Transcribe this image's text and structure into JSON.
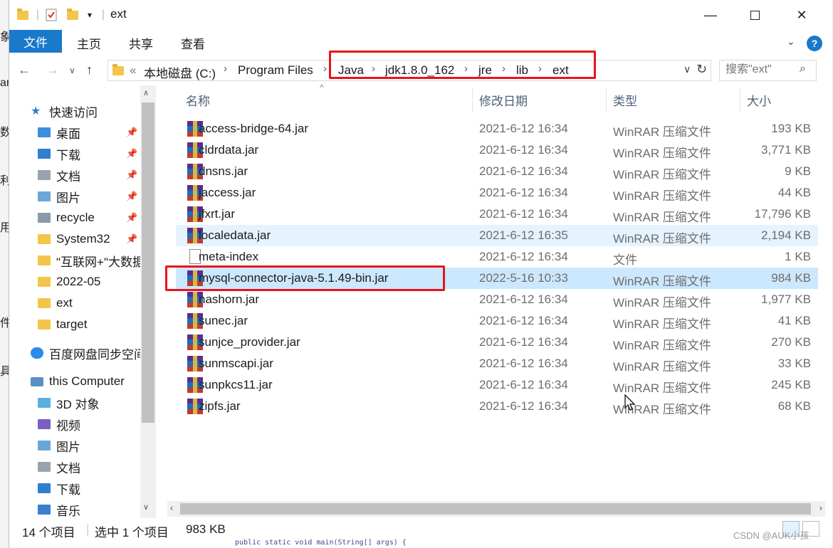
{
  "titlebar": {
    "title": "ext",
    "quick_access_separator": "|"
  },
  "ribbon": {
    "tabs": [
      "文件",
      "主页",
      "共享",
      "查看"
    ]
  },
  "nav": {
    "back": "←",
    "forward": "→",
    "dropdown": "∨",
    "up": "↑",
    "crumbs": [
      "«",
      "本地磁盘 (C:)",
      "Program Files",
      "Java",
      "jdk1.8.0_162",
      "jre",
      "lib",
      "ext"
    ],
    "search_placeholder": "搜索\"ext\""
  },
  "sidebar": {
    "items": [
      {
        "label": "快速访问",
        "icon": "star-icon",
        "pinned": false
      },
      {
        "label": "桌面",
        "icon": "desktop-folder-icon",
        "pinned": true
      },
      {
        "label": "下载",
        "icon": "download-folder-icon",
        "pinned": true
      },
      {
        "label": "文档",
        "icon": "documents-folder-icon",
        "pinned": true
      },
      {
        "label": "图片",
        "icon": "pictures-folder-icon",
        "pinned": true
      },
      {
        "label": "recycle",
        "icon": "recycle-bin-icon",
        "pinned": true
      },
      {
        "label": "System32",
        "icon": "folder-icon",
        "pinned": true
      },
      {
        "label": "\"互联网+\"大数据",
        "icon": "folder-icon",
        "pinned": false
      },
      {
        "label": "2022-05",
        "icon": "folder-icon",
        "pinned": false
      },
      {
        "label": "ext",
        "icon": "folder-icon",
        "pinned": false
      },
      {
        "label": "target",
        "icon": "folder-icon",
        "pinned": false
      },
      {
        "label": "百度网盘同步空间",
        "icon": "baidu-cloud-icon",
        "pinned": false
      },
      {
        "label": "this Computer",
        "icon": "computer-icon",
        "pinned": false
      },
      {
        "label": "3D 对象",
        "icon": "3d-objects-icon",
        "pinned": false
      },
      {
        "label": "视频",
        "icon": "videos-folder-icon",
        "pinned": false
      },
      {
        "label": "图片",
        "icon": "pictures-folder-icon",
        "pinned": false
      },
      {
        "label": "文档",
        "icon": "documents-folder-icon",
        "pinned": false
      },
      {
        "label": "下载",
        "icon": "download-folder-icon",
        "pinned": false
      },
      {
        "label": "音乐",
        "icon": "music-folder-icon",
        "pinned": false
      }
    ]
  },
  "columns": {
    "name": "名称",
    "date": "修改日期",
    "type": "类型",
    "size": "大小"
  },
  "files": [
    {
      "name": "access-bridge-64.jar",
      "date": "2021-6-12 16:34",
      "type": "WinRAR 压缩文件",
      "size": "193 KB",
      "kind": "rar"
    },
    {
      "name": "cldrdata.jar",
      "date": "2021-6-12 16:34",
      "type": "WinRAR 压缩文件",
      "size": "3,771 KB",
      "kind": "rar"
    },
    {
      "name": "dnsns.jar",
      "date": "2021-6-12 16:34",
      "type": "WinRAR 压缩文件",
      "size": "9 KB",
      "kind": "rar"
    },
    {
      "name": "jaccess.jar",
      "date": "2021-6-12 16:34",
      "type": "WinRAR 压缩文件",
      "size": "44 KB",
      "kind": "rar"
    },
    {
      "name": "jfxrt.jar",
      "date": "2021-6-12 16:34",
      "type": "WinRAR 压缩文件",
      "size": "17,796 KB",
      "kind": "rar"
    },
    {
      "name": "localedata.jar",
      "date": "2021-6-12 16:35",
      "type": "WinRAR 压缩文件",
      "size": "2,194 KB",
      "kind": "rar"
    },
    {
      "name": "meta-index",
      "date": "2021-6-12 16:34",
      "type": "文件",
      "size": "1 KB",
      "kind": "doc"
    },
    {
      "name": "mysql-connector-java-5.1.49-bin.jar",
      "date": "2022-5-16 10:33",
      "type": "WinRAR 压缩文件",
      "size": "984 KB",
      "kind": "rar"
    },
    {
      "name": "nashorn.jar",
      "date": "2021-6-12 16:34",
      "type": "WinRAR 压缩文件",
      "size": "1,977 KB",
      "kind": "rar"
    },
    {
      "name": "sunec.jar",
      "date": "2021-6-12 16:34",
      "type": "WinRAR 压缩文件",
      "size": "41 KB",
      "kind": "rar"
    },
    {
      "name": "sunjce_provider.jar",
      "date": "2021-6-12 16:34",
      "type": "WinRAR 压缩文件",
      "size": "270 KB",
      "kind": "rar"
    },
    {
      "name": "sunmscapi.jar",
      "date": "2021-6-12 16:34",
      "type": "WinRAR 压缩文件",
      "size": "33 KB",
      "kind": "rar"
    },
    {
      "name": "sunpkcs11.jar",
      "date": "2021-6-12 16:34",
      "type": "WinRAR 压缩文件",
      "size": "245 KB",
      "kind": "rar"
    },
    {
      "name": "zipfs.jar",
      "date": "2021-6-12 16:34",
      "type": "WinRAR 压缩文件",
      "size": "68 KB",
      "kind": "rar"
    }
  ],
  "status": {
    "count": "14 个项目",
    "selected": "选中 1 个项目",
    "selected_size": "983 KB"
  },
  "background": {
    "left_glyphs": [
      "象",
      "ar",
      "数",
      "利",
      "用",
      "件",
      "具"
    ],
    "code_snippet": "public static void main(String[] args) {",
    "watermark": "CSDN @AUK小孩"
  },
  "colors": {
    "accent": "#1979ca",
    "selected_row": "#cce8ff",
    "hover_row": "#e5f3ff",
    "annotation": "#e8141a"
  }
}
